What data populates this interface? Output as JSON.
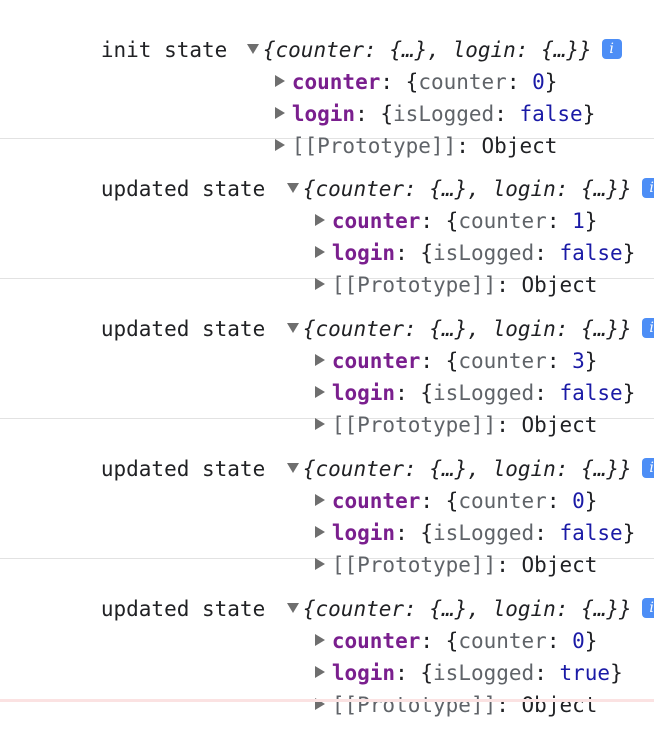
{
  "entries": [
    {
      "message": "init state",
      "preview_open": "{",
      "preview_key1": "counter",
      "preview_sep1": ": ",
      "preview_val1": "{…}",
      "preview_comma": ", ",
      "preview_key2": "login",
      "preview_sep2": ": ",
      "preview_val2": "{…}",
      "preview_close": "}",
      "info_label": "i",
      "counter_key": "counter",
      "counter_inner_key": "counter",
      "counter_value": "0",
      "login_key": "login",
      "login_inner_key": "isLogged",
      "login_value": "false",
      "prototype_label": "[[Prototype]]",
      "prototype_value": "Object"
    },
    {
      "message": "updated state",
      "preview_open": "{",
      "preview_key1": "counter",
      "preview_sep1": ": ",
      "preview_val1": "{…}",
      "preview_comma": ", ",
      "preview_key2": "login",
      "preview_sep2": ": ",
      "preview_val2": "{…}",
      "preview_close": "}",
      "info_label": "i",
      "counter_key": "counter",
      "counter_inner_key": "counter",
      "counter_value": "1",
      "login_key": "login",
      "login_inner_key": "isLogged",
      "login_value": "false",
      "prototype_label": "[[Prototype]]",
      "prototype_value": "Object"
    },
    {
      "message": "updated state",
      "preview_open": "{",
      "preview_key1": "counter",
      "preview_sep1": ": ",
      "preview_val1": "{…}",
      "preview_comma": ", ",
      "preview_key2": "login",
      "preview_sep2": ": ",
      "preview_val2": "{…}",
      "preview_close": "}",
      "info_label": "i",
      "counter_key": "counter",
      "counter_inner_key": "counter",
      "counter_value": "3",
      "login_key": "login",
      "login_inner_key": "isLogged",
      "login_value": "false",
      "prototype_label": "[[Prototype]]",
      "prototype_value": "Object"
    },
    {
      "message": "updated state",
      "preview_open": "{",
      "preview_key1": "counter",
      "preview_sep1": ": ",
      "preview_val1": "{…}",
      "preview_comma": ", ",
      "preview_key2": "login",
      "preview_sep2": ": ",
      "preview_val2": "{…}",
      "preview_close": "}",
      "info_label": "i",
      "counter_key": "counter",
      "counter_inner_key": "counter",
      "counter_value": "0",
      "login_key": "login",
      "login_inner_key": "isLogged",
      "login_value": "false",
      "prototype_label": "[[Prototype]]",
      "prototype_value": "Object"
    },
    {
      "message": "updated state",
      "preview_open": "{",
      "preview_key1": "counter",
      "preview_sep1": ": ",
      "preview_val1": "{…}",
      "preview_comma": ", ",
      "preview_key2": "login",
      "preview_sep2": ": ",
      "preview_val2": "{…}",
      "preview_close": "}",
      "info_label": "i",
      "counter_key": "counter",
      "counter_inner_key": "counter",
      "counter_value": "0",
      "login_key": "login",
      "login_inner_key": "isLogged",
      "login_value": "true",
      "prototype_label": "[[Prototype]]",
      "prototype_value": "Object"
    }
  ],
  "colors": {
    "key": "#7a1f8e",
    "value": "#1a1aa6",
    "info_badge": "#4d8ef6",
    "divider": "#e2e2e2"
  }
}
